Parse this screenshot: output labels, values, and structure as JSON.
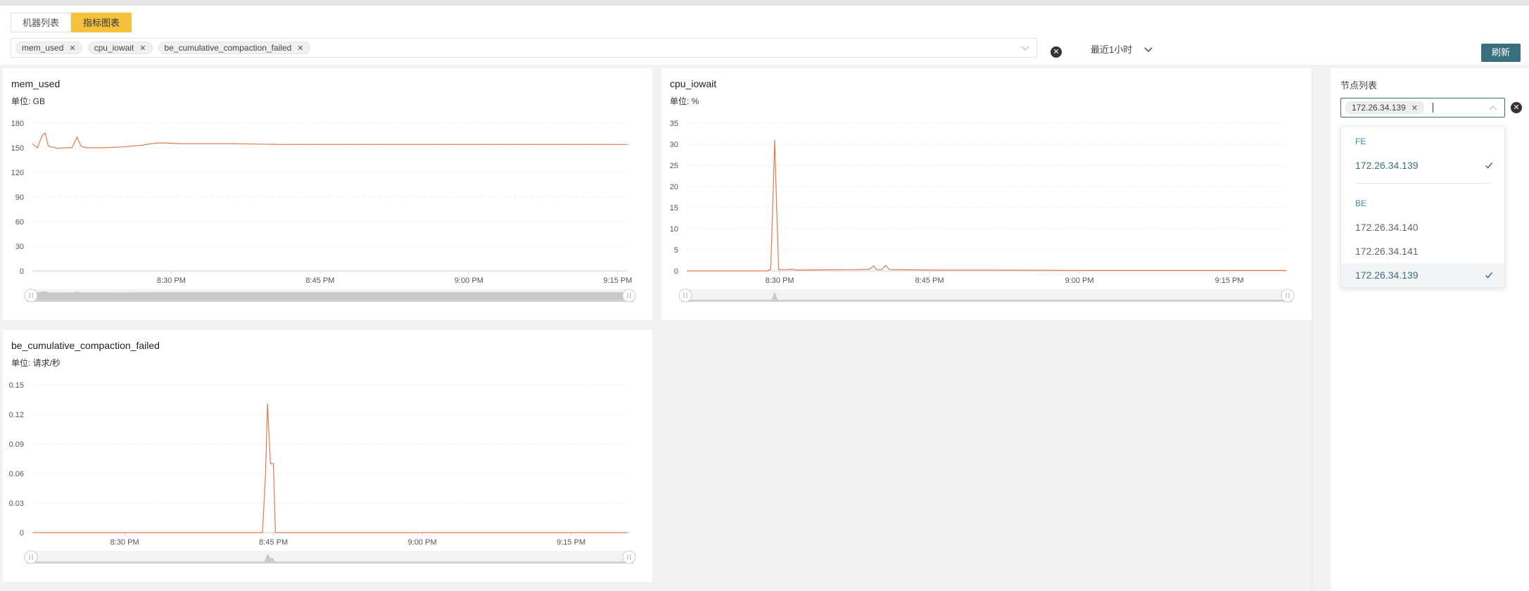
{
  "tabs": [
    {
      "label": "机器列表",
      "active": false
    },
    {
      "label": "指标图表",
      "active": true
    }
  ],
  "metrics_selected": [
    {
      "label": "mem_used"
    },
    {
      "label": "cpu_iowait"
    },
    {
      "label": "be_cumulative_compaction_failed"
    }
  ],
  "time_range": "最近1小时",
  "refresh_label": "刷新",
  "node_panel": {
    "title": "节点列表",
    "selected_chip": "172.26.34.139",
    "groups": [
      {
        "label": "FE",
        "items": [
          {
            "label": "172.26.34.139",
            "selected": true
          }
        ]
      },
      {
        "label": "BE",
        "items": [
          {
            "label": "172.26.34.140",
            "selected": false
          },
          {
            "label": "172.26.34.141",
            "selected": false
          },
          {
            "label": "172.26.34.139",
            "selected": true
          }
        ]
      }
    ]
  },
  "colors": {
    "line": "#e07a4c",
    "accent": "#3a6f80",
    "tab_active": "#f4c23c",
    "group": "#3a8fb7"
  },
  "chart_data": [
    {
      "type": "line",
      "title": "mem_used",
      "unit_label": "单位: GB",
      "ylim": [
        0,
        180
      ],
      "y_ticks": [
        0,
        30,
        60,
        90,
        120,
        150,
        180
      ],
      "x_range": [
        0,
        60
      ],
      "x_ticks": [
        {
          "x": 14,
          "label": "8:30 PM"
        },
        {
          "x": 29,
          "label": "8:45 PM"
        },
        {
          "x": 44,
          "label": "9:00 PM"
        },
        {
          "x": 59,
          "label": "9:15 PM"
        }
      ],
      "series": [
        {
          "values": [
            [
              0,
              155
            ],
            [
              0.5,
              150
            ],
            [
              1,
              165
            ],
            [
              1.3,
              168
            ],
            [
              1.6,
              152
            ],
            [
              2,
              151
            ],
            [
              2.6,
              149
            ],
            [
              3.2,
              150
            ],
            [
              4,
              150
            ],
            [
              4.5,
              163
            ],
            [
              4.9,
              152
            ],
            [
              5.5,
              150
            ],
            [
              7,
              150
            ],
            [
              9,
              151
            ],
            [
              10,
              152
            ],
            [
              11,
              153
            ],
            [
              12,
              155
            ],
            [
              13,
              156
            ],
            [
              15,
              155
            ],
            [
              20,
              155
            ],
            [
              25,
              154
            ],
            [
              30,
              154
            ],
            [
              35,
              154
            ],
            [
              40,
              154
            ],
            [
              45,
              154
            ],
            [
              50,
              154
            ],
            [
              55,
              154
            ],
            [
              60,
              154
            ]
          ]
        }
      ],
      "grid": true
    },
    {
      "type": "line",
      "title": "cpu_iowait",
      "unit_label": "单位: %",
      "ylim": [
        0,
        35
      ],
      "y_ticks": [
        0,
        5,
        10,
        15,
        20,
        25,
        30,
        35
      ],
      "x_range": [
        0,
        60
      ],
      "x_ticks": [
        {
          "x": 9.3,
          "label": "8:30 PM"
        },
        {
          "x": 24.3,
          "label": "8:45 PM"
        },
        {
          "x": 39.3,
          "label": "9:00 PM"
        },
        {
          "x": 54.3,
          "label": "9:15 PM"
        }
      ],
      "series": [
        {
          "values": [
            [
              0,
              0
            ],
            [
              8,
              0
            ],
            [
              8.4,
              0.3
            ],
            [
              8.6,
              15
            ],
            [
              8.8,
              31
            ],
            [
              9.0,
              15
            ],
            [
              9.2,
              0.3
            ],
            [
              10,
              0.3
            ],
            [
              10.5,
              0.4
            ],
            [
              11,
              0.2
            ],
            [
              17,
              0.3
            ],
            [
              18.3,
              0.4
            ],
            [
              18.7,
              1.2
            ],
            [
              19.0,
              0.3
            ],
            [
              19.5,
              0.3
            ],
            [
              19.9,
              1.3
            ],
            [
              20.3,
              0.3
            ],
            [
              25,
              0.2
            ],
            [
              30,
              0.2
            ],
            [
              40,
              0.1
            ],
            [
              50,
              0.1
            ],
            [
              60,
              0.1
            ]
          ]
        }
      ],
      "grid": true
    },
    {
      "type": "line",
      "title": "be_cumulative_compaction_failed",
      "unit_label": "单位: 请求/秒",
      "ylim": [
        0,
        0.15
      ],
      "y_ticks": [
        0,
        0.03,
        0.06,
        0.09,
        0.12,
        0.15
      ],
      "x_range": [
        0,
        60
      ],
      "x_ticks": [
        {
          "x": 9.3,
          "label": "8:30 PM"
        },
        {
          "x": 24.3,
          "label": "8:45 PM"
        },
        {
          "x": 39.3,
          "label": "9:00 PM"
        },
        {
          "x": 54.3,
          "label": "9:15 PM"
        }
      ],
      "series": [
        {
          "values": [
            [
              0,
              0
            ],
            [
              23.2,
              0
            ],
            [
              23.5,
              0.06
            ],
            [
              23.7,
              0.131
            ],
            [
              24.0,
              0.07
            ],
            [
              24.3,
              0.07
            ],
            [
              24.5,
              0
            ],
            [
              60,
              0
            ]
          ]
        }
      ],
      "grid": true
    }
  ]
}
